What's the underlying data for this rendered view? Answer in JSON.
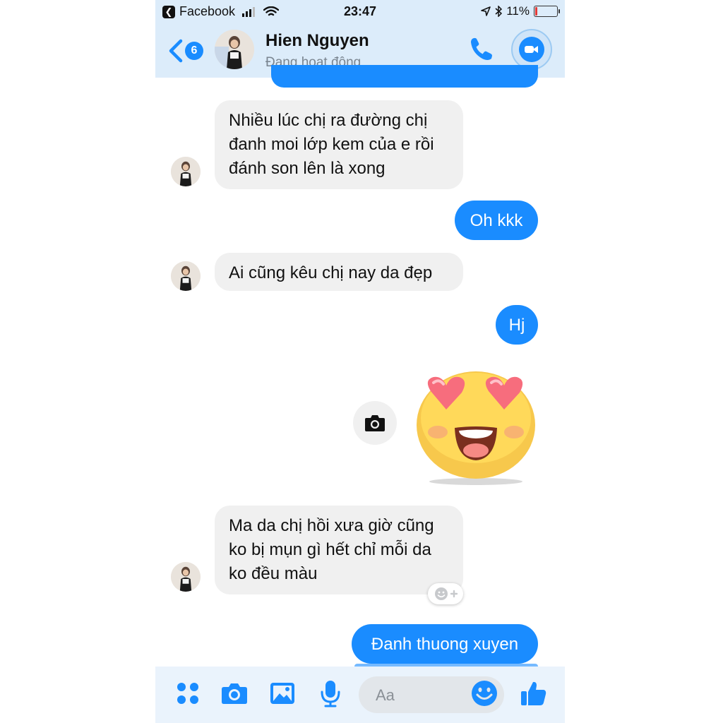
{
  "status_bar": {
    "back_app": "Facebook",
    "time": "23:47",
    "battery": "11%",
    "battery_level": 0.11,
    "icons": [
      "back-arrow-icon",
      "signal-icon",
      "wifi-icon",
      "location-icon",
      "bluetooth-icon",
      "battery-icon"
    ]
  },
  "header": {
    "unread_count": "6",
    "name": "Hien Nguyen",
    "presence": "Đang hoạt động",
    "icons": [
      "back-chevron-icon",
      "phone-icon",
      "video-camera-icon"
    ]
  },
  "messages": [
    {
      "side": "in",
      "text": "Nhiều lúc chị ra đường chị\nđanh moi lớp kem của e rồi\nđánh son lên là xong"
    },
    {
      "side": "out",
      "text": "Oh kkk"
    },
    {
      "side": "in",
      "text": "Ai cũng kêu chị nay da đẹp"
    },
    {
      "side": "out",
      "text": "Hj"
    },
    {
      "side": "out",
      "sticker": "heart-eyes-sticker"
    },
    {
      "side": "in",
      "text": "Ma da chị hồi xưa giờ cũng\nko bị mụn gì hết chỉ mỗi da\nko đều màu"
    },
    {
      "side": "out",
      "text": "Đanh thuong xuyen"
    }
  ],
  "composer": {
    "placeholder": "Aa",
    "icons": [
      "menu-dots-icon",
      "camera-icon",
      "gallery-icon",
      "microphone-icon",
      "smiley-icon",
      "thumbs-up-icon"
    ]
  },
  "colors": {
    "accent": "#1a8cff",
    "incoming_bubble": "#f0f0f0",
    "header_bg": "#dcecfa"
  }
}
